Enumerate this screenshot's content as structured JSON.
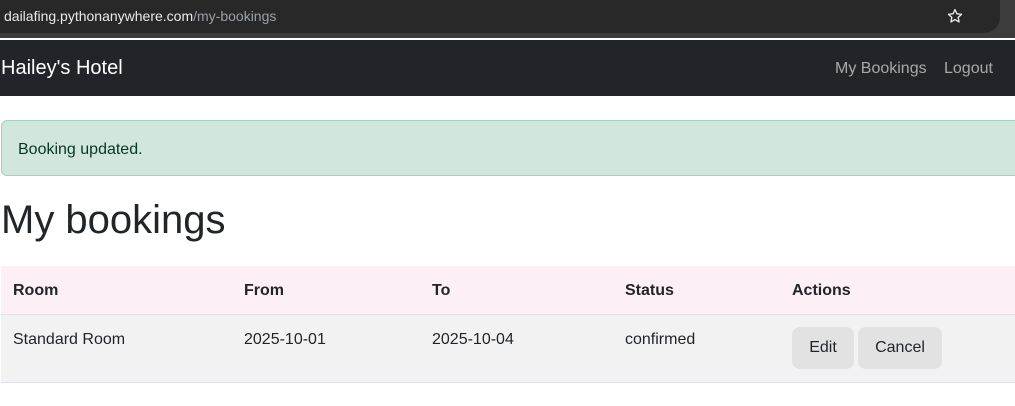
{
  "browser": {
    "url_host": "dailafing.pythonanywhere.com",
    "url_path": "/my-bookings"
  },
  "navbar": {
    "brand": "Hailey's Hotel",
    "links": [
      "My Bookings",
      "Logout"
    ]
  },
  "alert": {
    "message": "Booking updated.",
    "type": "success",
    "color": "#d1e7dd"
  },
  "page": {
    "title": "My bookings"
  },
  "table": {
    "headers": [
      "Room",
      "From",
      "To",
      "Status",
      "Actions"
    ],
    "rows": [
      {
        "room": "Standard Room",
        "from": "2025-10-01",
        "to": "2025-10-04",
        "status": "confirmed",
        "actions": [
          "Edit",
          "Cancel"
        ]
      }
    ]
  },
  "colors": {
    "navbar_bg": "#212529",
    "header_row_bg": "#fdeff6",
    "row_bg": "#f2f2f2"
  },
  "icons": [
    "tune-icon",
    "bookmark-star-icon"
  ]
}
